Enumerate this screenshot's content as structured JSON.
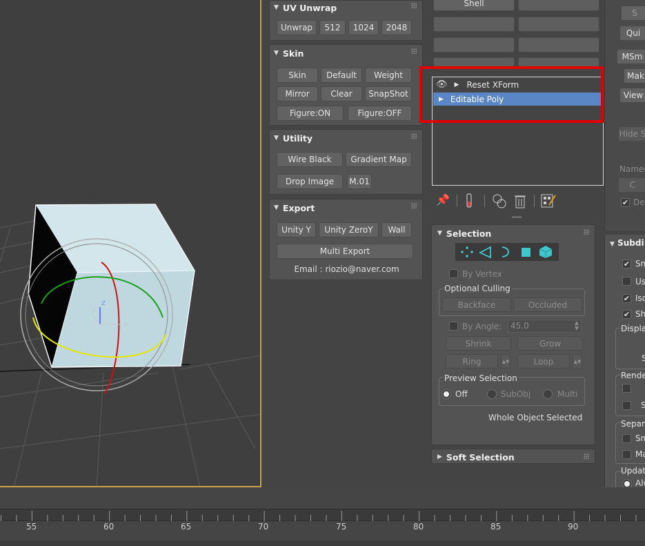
{
  "uv_unwrap": {
    "title": "UV Unwrap",
    "buttons": [
      "Unwrap",
      "512",
      "1024",
      "2048"
    ]
  },
  "skin": {
    "title": "Skin",
    "row1": [
      "Skin",
      "Default",
      "Weight"
    ],
    "row2": [
      "Mirror",
      "Clear",
      "SnapShot"
    ],
    "row3": [
      "Figure:ON",
      "Figure:OFF"
    ]
  },
  "utility": {
    "title": "Utility",
    "row1": [
      "Wire Black",
      "Gradient Map"
    ],
    "row2": [
      "Drop Image",
      "M.01"
    ]
  },
  "export": {
    "title": "Export",
    "row1": [
      "Unity Y",
      "Unity ZeroY",
      "Wall"
    ],
    "multi_export": "Multi Export",
    "email": "Email : riozio@naver.com"
  },
  "modifier_sets": {
    "shell": "Shell"
  },
  "modifier_stack": {
    "items": [
      {
        "label": "Reset XForm",
        "selected": false
      },
      {
        "label": "Editable Poly",
        "selected": true
      }
    ]
  },
  "selection": {
    "title": "Selection",
    "by_vertex": "By Vertex",
    "optional_culling": "Optional Culling",
    "backface": "Backface",
    "occluded": "Occluded",
    "by_angle": "By Angle:",
    "angle_value": "45.0",
    "shrink": "Shrink",
    "grow": "Grow",
    "ring": "Ring",
    "loop": "Loop",
    "preview_selection": "Preview Selection",
    "off": "Off",
    "subobj": "SubObj",
    "multi": "Multi",
    "status": "Whole Object Selected"
  },
  "soft_selection": {
    "title": "Soft Selection"
  },
  "right_panel": {
    "btn_s": "S",
    "btn_qui": "Qui",
    "msm": "MSm",
    "mak": "Mak",
    "view": "View",
    "hide": "Hide S",
    "named": "Named",
    "c": "C",
    "de": "De",
    "subdiv": "Subdi",
    "sm": "Sm",
    "us": "Us",
    "iso": "Iso",
    "sh": "Sh",
    "displ": "Displa",
    "s2": "S",
    "rende": "Rende",
    "s3": "S",
    "separ": "Separ",
    "sm2": "Sm",
    "ma": "Ma",
    "update": "Update",
    "alw": "Alw"
  },
  "timeline": {
    "labels": [
      "55",
      "60",
      "65",
      "70",
      "75",
      "80",
      "85",
      "90"
    ]
  },
  "colors": {
    "highlight": "#e00000",
    "selection_blue": "#5b86c6",
    "viewport_border": "#c9a24a",
    "accent_cyan": "#3fc6cc"
  }
}
